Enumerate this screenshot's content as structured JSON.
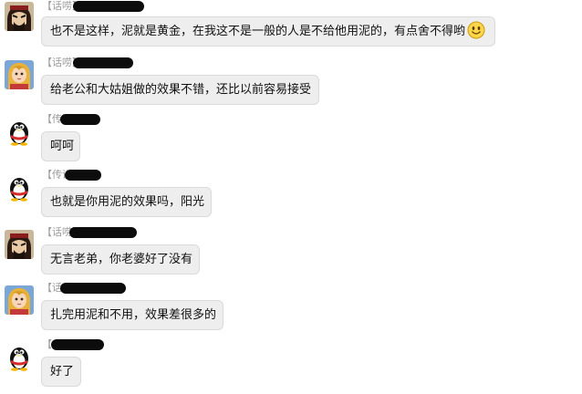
{
  "messages": [
    {
      "avatar": "hero-warrior-avatar",
      "sender_tag": "【话唠】",
      "text": "也不是这样，泥就是黄金，在我这不是一般的人是不给他用泥的，有点舍不得哟",
      "emoji": "smile-emoji-icon"
    },
    {
      "avatar": "anime-girl-avatar",
      "sender_tag": "【话唠】",
      "text": "给老公和大姑姐做的效果不错，还比以前容易接受"
    },
    {
      "avatar": "qq-penguin-avatar",
      "sender_tag": "【传说】",
      "text": "呵呵"
    },
    {
      "avatar": "qq-penguin-avatar",
      "sender_tag": "【传说】",
      "text": "也就是你用泥的效果吗，阳光"
    },
    {
      "avatar": "hero-warrior-avatar",
      "sender_tag": "【话唠】",
      "text": "无言老弟，你老婆好了没有"
    },
    {
      "avatar": "anime-girl-avatar",
      "sender_tag": "【话唠】",
      "text": "扎完用泥和不用，效果差很多的"
    },
    {
      "avatar": "qq-penguin-avatar",
      "sender_tag": "【",
      "text": "好了"
    }
  ],
  "colors": {
    "bubble_bg": "#eeeeee",
    "bubble_border": "#dadada",
    "sender_text": "#9a9a9a",
    "message_text": "#111111",
    "redaction": "#0c0c0c"
  }
}
